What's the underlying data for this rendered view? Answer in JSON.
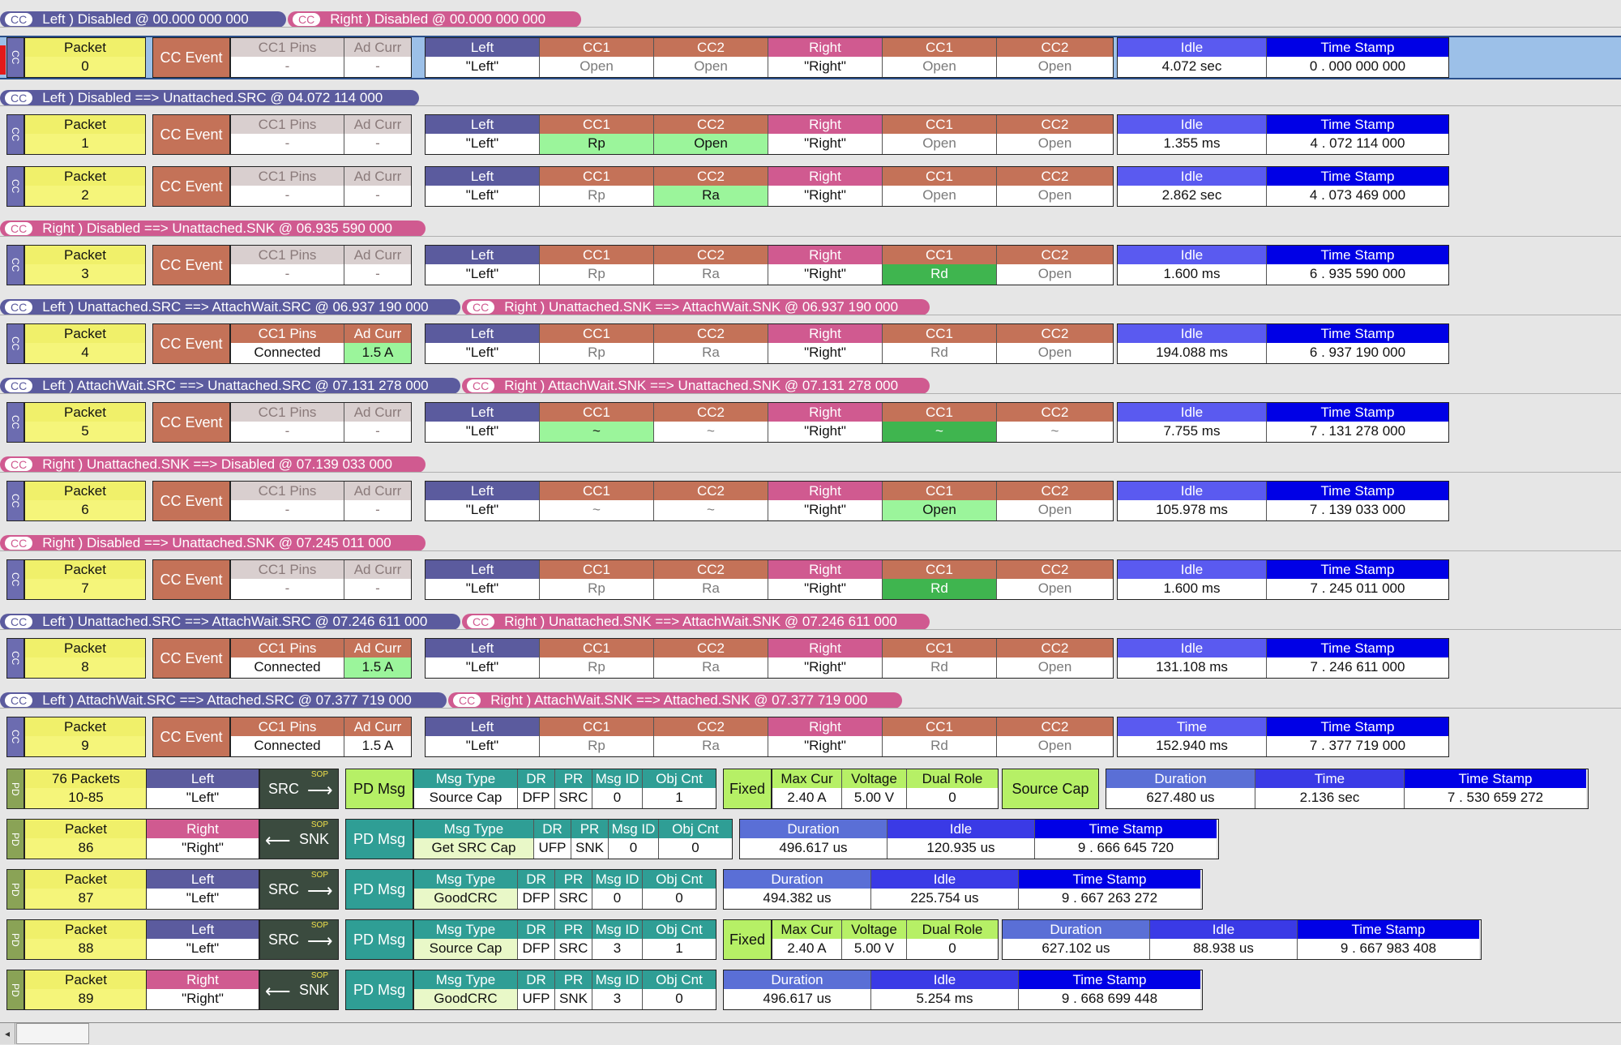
{
  "strips": [
    [
      {
        "side": "left",
        "text": "Left ) Disabled @ 00.000 000 000"
      },
      {
        "side": "right",
        "text": "Right ) Disabled @ 00.000 000 000"
      }
    ],
    [
      {
        "side": "left",
        "text": "Left ) Disabled ==> Unattached.SRC @ 04.072 114 000"
      }
    ],
    [
      {
        "side": "right",
        "text": "Right ) Disabled ==> Unattached.SNK @ 06.935 590 000"
      }
    ],
    [
      {
        "side": "left",
        "text": "Left ) Unattached.SRC ==> AttachWait.SRC @ 06.937 190 000"
      },
      {
        "side": "right",
        "text": "Right ) Unattached.SNK ==> AttachWait.SNK @ 06.937 190 000"
      }
    ],
    [
      {
        "side": "left",
        "text": "Left ) AttachWait.SRC ==> Unattached.SRC @ 07.131 278 000"
      },
      {
        "side": "right",
        "text": "Right ) AttachWait.SNK ==> Unattached.SNK @ 07.131 278 000"
      }
    ],
    [
      {
        "side": "right",
        "text": "Right ) Unattached.SNK ==> Disabled @ 07.139 033 000"
      }
    ],
    [
      {
        "side": "right",
        "text": "Right ) Disabled ==> Unattached.SNK @ 07.245 011 000"
      }
    ],
    [
      {
        "side": "left",
        "text": "Left ) Unattached.SRC ==> AttachWait.SRC @ 07.246 611 000"
      },
      {
        "side": "right",
        "text": "Right ) Unattached.SNK ==> AttachWait.SNK @ 07.246 611 000"
      }
    ],
    [
      {
        "side": "left",
        "text": "Left ) AttachWait.SRC ==> Attached.SRC @ 07.377 719 000"
      },
      {
        "side": "right",
        "text": "Right ) AttachWait.SNK ==> Attached.SNK @ 07.377 719 000"
      }
    ]
  ],
  "strip_cc_label": "CC",
  "side_labels": {
    "cc": "CC",
    "pd": "PD"
  },
  "cc_packets": [
    {
      "packet_label": "Packet",
      "packet": "0",
      "event": "CC Event",
      "pins_label": "CC1 Pins",
      "pins": "-",
      "adcurr_label": "Ad Curr",
      "adcurr": "-",
      "active": false,
      "left": "\"Left\"",
      "lcc1": "Open",
      "lcc2": "Open",
      "right": "\"Right\"",
      "rcc1": "Open",
      "rcc2": "Open",
      "idle_label": "Idle",
      "idle": "4.072 sec",
      "ts_label": "Time Stamp",
      "ts": "0 . 000 000 000",
      "hl": {}
    },
    {
      "packet_label": "Packet",
      "packet": "1",
      "event": "CC Event",
      "pins_label": "CC1 Pins",
      "pins": "-",
      "adcurr_label": "Ad Curr",
      "adcurr": "-",
      "active": false,
      "left": "\"Left\"",
      "lcc1": "Rp",
      "lcc2": "Open",
      "right": "\"Right\"",
      "rcc1": "Open",
      "rcc2": "Open",
      "idle_label": "Idle",
      "idle": "1.355 ms",
      "ts_label": "Time Stamp",
      "ts": "4 . 072 114 000",
      "hl": {
        "lcc1": "#9bf59b",
        "lcc2": "#9bf59b"
      }
    },
    {
      "packet_label": "Packet",
      "packet": "2",
      "event": "CC Event",
      "pins_label": "CC1 Pins",
      "pins": "-",
      "adcurr_label": "Ad Curr",
      "adcurr": "-",
      "active": false,
      "left": "\"Left\"",
      "lcc1": "Rp",
      "lcc2": "Ra",
      "right": "\"Right\"",
      "rcc1": "Open",
      "rcc2": "Open",
      "idle_label": "Idle",
      "idle": "2.862 sec",
      "ts_label": "Time Stamp",
      "ts": "4 . 073 469 000",
      "hl": {
        "lcc2": "#9bf59b"
      }
    },
    {
      "packet_label": "Packet",
      "packet": "3",
      "event": "CC Event",
      "pins_label": "CC1 Pins",
      "pins": "-",
      "adcurr_label": "Ad Curr",
      "adcurr": "-",
      "active": false,
      "left": "\"Left\"",
      "lcc1": "Rp",
      "lcc2": "Ra",
      "right": "\"Right\"",
      "rcc1": "Rd",
      "rcc2": "Open",
      "idle_label": "Idle",
      "idle": "1.600 ms",
      "ts_label": "Time Stamp",
      "ts": "6 . 935 590 000",
      "hl": {
        "rcc1": "#3fb54f"
      }
    },
    {
      "packet_label": "Packet",
      "packet": "4",
      "event": "CC Event",
      "pins_label": "CC1 Pins",
      "pins": "Connected",
      "adcurr_label": "Ad Curr",
      "adcurr": "1.5 A",
      "active": true,
      "left": "\"Left\"",
      "lcc1": "Rp",
      "lcc2": "Ra",
      "right": "\"Right\"",
      "rcc1": "Rd",
      "rcc2": "Open",
      "idle_label": "Idle",
      "idle": "194.088 ms",
      "ts_label": "Time Stamp",
      "ts": "6 . 937 190 000",
      "hl": {
        "adcurr": "#9bf59b"
      }
    },
    {
      "packet_label": "Packet",
      "packet": "5",
      "event": "CC Event",
      "pins_label": "CC1 Pins",
      "pins": "-",
      "adcurr_label": "Ad Curr",
      "adcurr": "-",
      "active": false,
      "left": "\"Left\"",
      "lcc1": "~",
      "lcc2": "~",
      "right": "\"Right\"",
      "rcc1": "~",
      "rcc2": "~",
      "idle_label": "Idle",
      "idle": "7.755 ms",
      "ts_label": "Time Stamp",
      "ts": "7 . 131 278 000",
      "hl": {
        "lcc1": "#9bf59b",
        "rcc1": "#3fb54f"
      }
    },
    {
      "packet_label": "Packet",
      "packet": "6",
      "event": "CC Event",
      "pins_label": "CC1 Pins",
      "pins": "-",
      "adcurr_label": "Ad Curr",
      "adcurr": "-",
      "active": false,
      "left": "\"Left\"",
      "lcc1": "~",
      "lcc2": "~",
      "right": "\"Right\"",
      "rcc1": "Open",
      "rcc2": "Open",
      "idle_label": "Idle",
      "idle": "105.978 ms",
      "ts_label": "Time Stamp",
      "ts": "7 . 139 033 000",
      "hl": {
        "rcc1": "#9bf59b"
      }
    },
    {
      "packet_label": "Packet",
      "packet": "7",
      "event": "CC Event",
      "pins_label": "CC1 Pins",
      "pins": "-",
      "adcurr_label": "Ad Curr",
      "adcurr": "-",
      "active": false,
      "left": "\"Left\"",
      "lcc1": "Rp",
      "lcc2": "Ra",
      "right": "\"Right\"",
      "rcc1": "Rd",
      "rcc2": "Open",
      "idle_label": "Idle",
      "idle": "1.600 ms",
      "ts_label": "Time Stamp",
      "ts": "7 . 245 011 000",
      "hl": {
        "rcc1": "#3fb54f"
      }
    },
    {
      "packet_label": "Packet",
      "packet": "8",
      "event": "CC Event",
      "pins_label": "CC1 Pins",
      "pins": "Connected",
      "adcurr_label": "Ad Curr",
      "adcurr": "1.5 A",
      "active": true,
      "left": "\"Left\"",
      "lcc1": "Rp",
      "lcc2": "Ra",
      "right": "\"Right\"",
      "rcc1": "Rd",
      "rcc2": "Open",
      "idle_label": "Idle",
      "idle": "131.108 ms",
      "ts_label": "Time Stamp",
      "ts": "7 . 246 611 000",
      "hl": {
        "adcurr": "#9bf59b"
      }
    },
    {
      "packet_label": "Packet",
      "packet": "9",
      "event": "CC Event",
      "pins_label": "CC1 Pins",
      "pins": "Connected",
      "adcurr_label": "Ad Curr",
      "adcurr": "1.5 A",
      "active": true,
      "left": "\"Left\"",
      "lcc1": "Rp",
      "lcc2": "Ra",
      "right": "\"Right\"",
      "rcc1": "Rd",
      "rcc2": "Open",
      "idle_label": "Time",
      "idle": "152.940 ms",
      "ts_label": "Time Stamp",
      "ts": "7 . 377 719 000",
      "hl": {}
    }
  ],
  "cc_col_labels": {
    "left": "Left",
    "cc1": "CC1",
    "cc2": "CC2",
    "right": "Right"
  },
  "pd_packets": [
    {
      "packet_label": "76 Packets",
      "packet": "10-85",
      "side_label": "Left",
      "side": "\"Left\"",
      "dir": "SRC",
      "sop": "SOP",
      "msg": "PD Msg",
      "msg_type": "Source Cap",
      "dr": "DFP",
      "pr": "SRC",
      "msg_id": "0",
      "obj_cnt": "1",
      "pdo": {
        "fixed": "Fixed",
        "max_cur": "2.40 A",
        "voltage": "5.00 V",
        "dual_role": "0",
        "cap": "Source Cap"
      },
      "timing": [
        {
          "l": "Duration",
          "v": "627.480 us",
          "c": "#5a6fd6"
        },
        {
          "l": "Time",
          "v": "2.136 sec",
          "c": "#3a3ae6"
        },
        {
          "l": "Time Stamp",
          "v": "7 . 530 659 272",
          "c": "#0000e6"
        }
      ]
    },
    {
      "packet_label": "Packet",
      "packet": "86",
      "side_label": "Right",
      "side": "\"Right\"",
      "dir": "SNK",
      "sop": "SOP",
      "msg": "PD Msg",
      "msg_type": "Get SRC Cap",
      "dr": "UFP",
      "pr": "SNK",
      "msg_id": "0",
      "obj_cnt": "0",
      "pdo": null,
      "timing": [
        {
          "l": "Duration",
          "v": "496.617 us",
          "c": "#5a6fd6"
        },
        {
          "l": "Idle",
          "v": "120.935 us",
          "c": "#3a3ae6"
        },
        {
          "l": "Time Stamp",
          "v": "9 . 666 645 720",
          "c": "#0000e6"
        }
      ]
    },
    {
      "packet_label": "Packet",
      "packet": "87",
      "side_label": "Left",
      "side": "\"Left\"",
      "dir": "SRC",
      "sop": "SOP",
      "msg": "PD Msg",
      "msg_type": "GoodCRC",
      "dr": "DFP",
      "pr": "SRC",
      "msg_id": "0",
      "obj_cnt": "0",
      "pdo": null,
      "timing": [
        {
          "l": "Duration",
          "v": "494.382 us",
          "c": "#5a6fd6"
        },
        {
          "l": "Idle",
          "v": "225.754 us",
          "c": "#3a3ae6"
        },
        {
          "l": "Time Stamp",
          "v": "9 . 667 263 272",
          "c": "#0000e6"
        }
      ]
    },
    {
      "packet_label": "Packet",
      "packet": "88",
      "side_label": "Left",
      "side": "\"Left\"",
      "dir": "SRC",
      "sop": "SOP",
      "msg": "PD Msg",
      "msg_type": "Source Cap",
      "dr": "DFP",
      "pr": "SRC",
      "msg_id": "3",
      "obj_cnt": "1",
      "pdo": {
        "fixed": "Fixed",
        "max_cur": "2.40 A",
        "voltage": "5.00 V",
        "dual_role": "0",
        "cap": null
      },
      "timing": [
        {
          "l": "Duration",
          "v": "627.102 us",
          "c": "#5a6fd6"
        },
        {
          "l": "Idle",
          "v": "88.938 us",
          "c": "#3a3ae6"
        },
        {
          "l": "Time Stamp",
          "v": "9 . 667 983 408",
          "c": "#0000e6"
        }
      ]
    },
    {
      "packet_label": "Packet",
      "packet": "89",
      "side_label": "Right",
      "side": "\"Right\"",
      "dir": "SNK",
      "sop": "SOP",
      "msg": "PD Msg",
      "msg_type": "GoodCRC",
      "dr": "UFP",
      "pr": "SNK",
      "msg_id": "3",
      "obj_cnt": "0",
      "pdo": null,
      "timing": [
        {
          "l": "Duration",
          "v": "496.617 us",
          "c": "#5a6fd6"
        },
        {
          "l": "Idle",
          "v": "5.254 ms",
          "c": "#3a3ae6"
        },
        {
          "l": "Time Stamp",
          "v": "9 . 668 699 448",
          "c": "#0000e6"
        }
      ]
    }
  ],
  "pd_col_labels": {
    "msg_type": "Msg Type",
    "dr": "DR",
    "pr": "PR",
    "msg_id": "Msg ID",
    "obj_cnt": "Obj Cnt",
    "max_cur": "Max Cur",
    "voltage": "Voltage",
    "dual_role": "Dual Role"
  },
  "colors": {
    "packet_yellow": "#f5f57a",
    "packet_label": "#f0f06a",
    "cc_event": "#c47258",
    "pins_inactive": "#d9cfcf",
    "pins_active": "#c47258",
    "left_blue": "#5b5b9e",
    "cc_orange": "#c47258",
    "right_pink": "#d05a90",
    "idle": "#5a5af0",
    "timestamp": "#0000e6",
    "pd_green": "#b6f066",
    "pd_teal": "#2f9e95",
    "pdo_green": "#b6f066"
  }
}
